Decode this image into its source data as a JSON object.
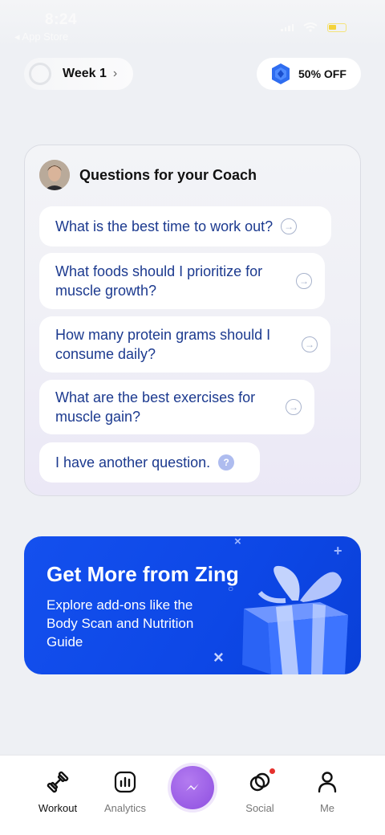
{
  "status_bar": {
    "time": "8:24",
    "back_label": "◂ App Store"
  },
  "header": {
    "week_label": "Week 1",
    "offer_label": "50% OFF"
  },
  "coach_card": {
    "title": "Questions for your Coach",
    "questions": [
      {
        "text": "What is the best time to work out?"
      },
      {
        "text": "What foods should I prioritize for muscle growth?"
      },
      {
        "text": "How many protein grams should I consume daily?"
      },
      {
        "text": "What are the best exercises for muscle gain?"
      },
      {
        "text": "I have another question."
      }
    ]
  },
  "promo": {
    "title": "Get More from Zing",
    "body": "Explore add-ons like the Body Scan and Nutrition Guide"
  },
  "tabbar": {
    "tabs": [
      {
        "label": "Workout",
        "icon": "dumbbell-icon",
        "active": true
      },
      {
        "label": "Analytics",
        "icon": "analytics-icon",
        "active": false
      },
      {
        "label": "",
        "icon": "messenger-icon",
        "active": false
      },
      {
        "label": "Social",
        "icon": "social-rings-icon",
        "active": false
      },
      {
        "label": "Me",
        "icon": "person-icon",
        "active": false
      }
    ]
  },
  "colors": {
    "question_text": "#1c3a8f",
    "promo_blue": "#0d47e6",
    "fab_purple": "#9a5fe6",
    "notification_red": "#e5312d"
  }
}
